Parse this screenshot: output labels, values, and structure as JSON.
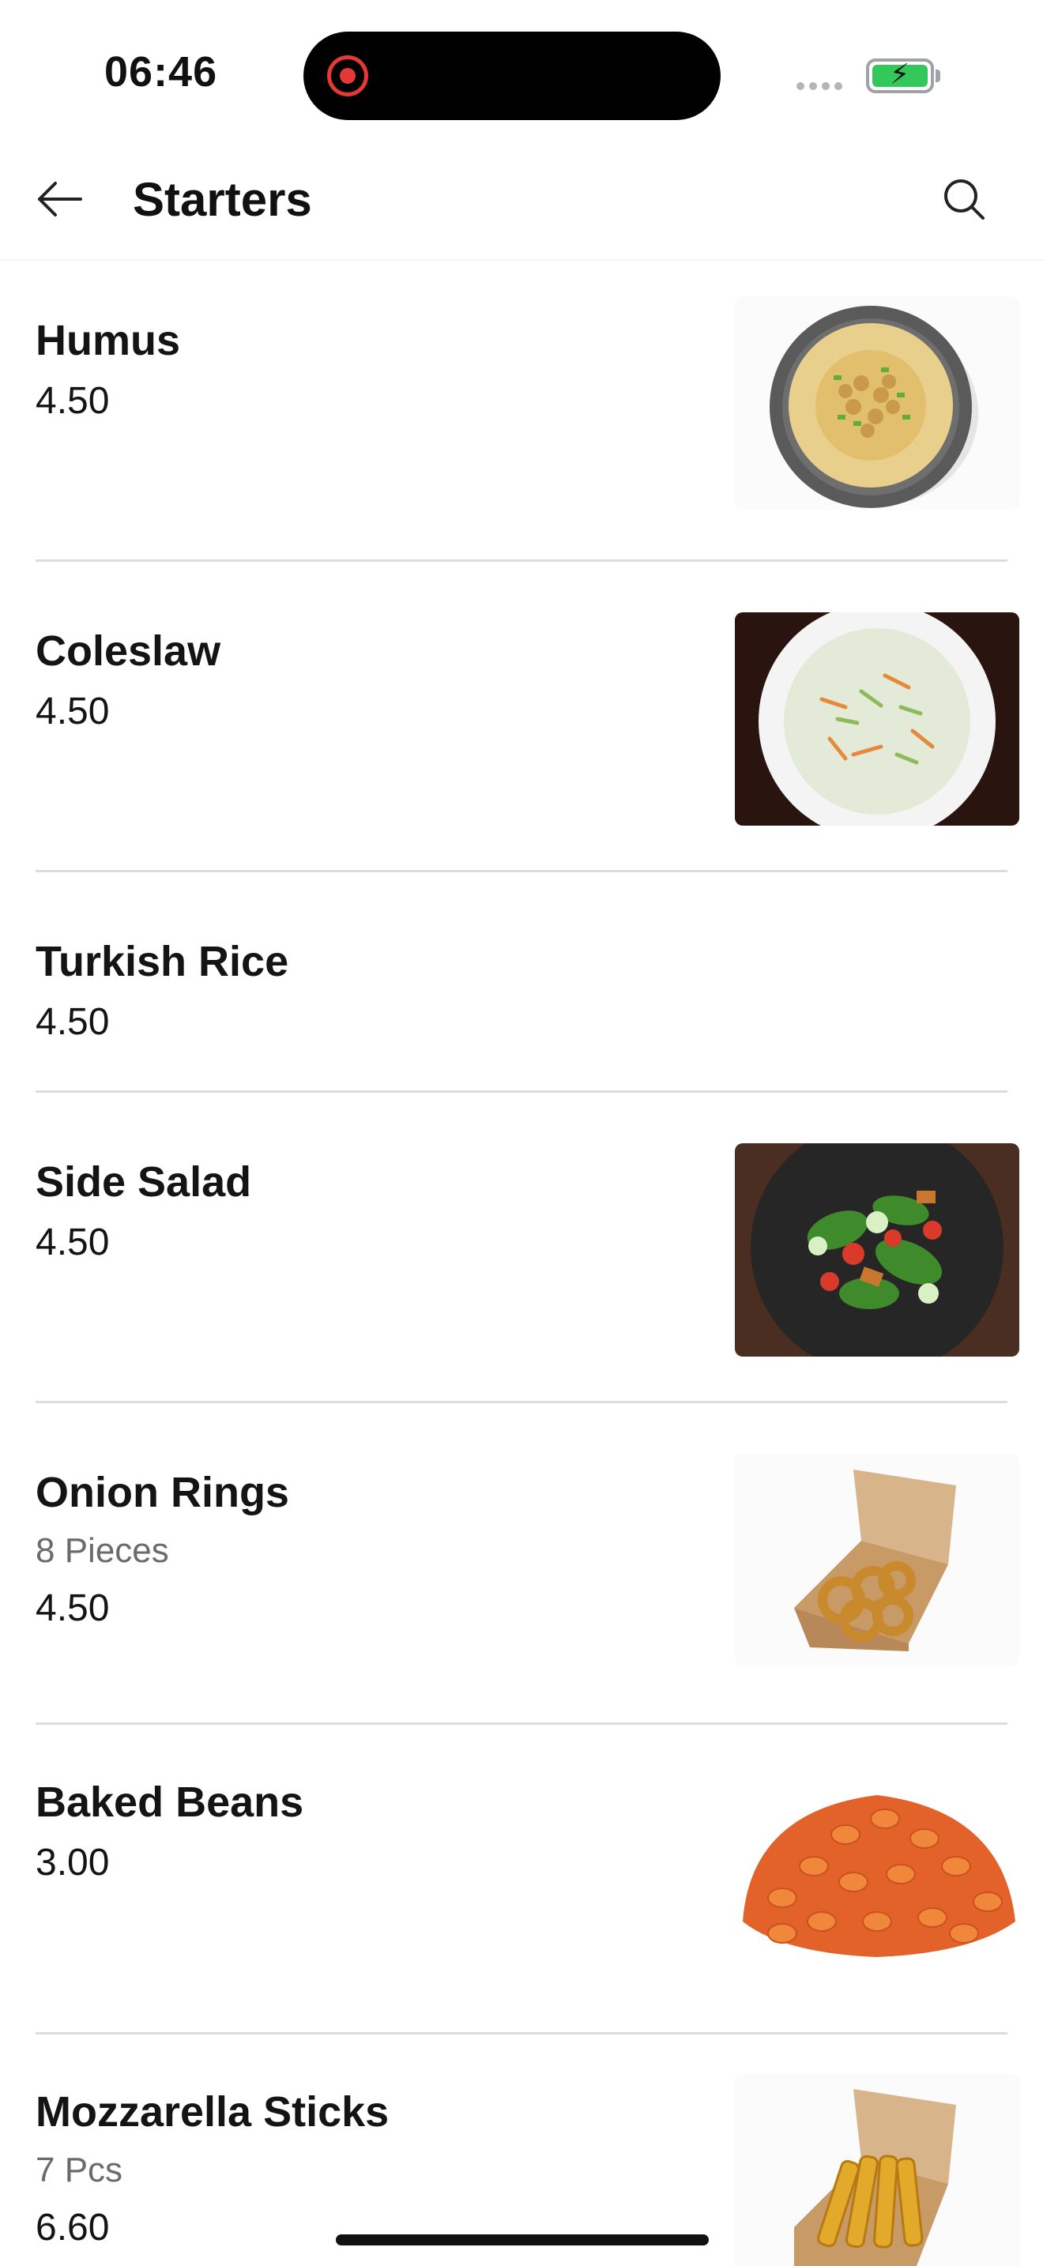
{
  "status_bar": {
    "time": "06:46",
    "recording": true,
    "battery_color": "#34c759"
  },
  "header": {
    "title": "Starters",
    "back_icon": "arrow-left-icon",
    "search_icon": "search-icon"
  },
  "menu": {
    "items": [
      {
        "name": "Humus",
        "subtitle": "",
        "price": "4.50",
        "image": "humus-bowl"
      },
      {
        "name": "Coleslaw",
        "subtitle": "",
        "price": "4.50",
        "image": "coleslaw-plate"
      },
      {
        "name": "Turkish Rice",
        "subtitle": "",
        "price": "4.50",
        "image": ""
      },
      {
        "name": "Side Salad",
        "subtitle": "",
        "price": "4.50",
        "image": "salad-bowl"
      },
      {
        "name": "Onion Rings",
        "subtitle": "8 Pieces",
        "price": "4.50",
        "image": "onion-rings-box"
      },
      {
        "name": "Baked Beans",
        "subtitle": "",
        "price": "3.00",
        "image": "baked-beans"
      },
      {
        "name": "Mozzarella Sticks",
        "subtitle": "7 Pcs",
        "price": "6.60",
        "image": "mozzarella-sticks-box"
      }
    ]
  }
}
